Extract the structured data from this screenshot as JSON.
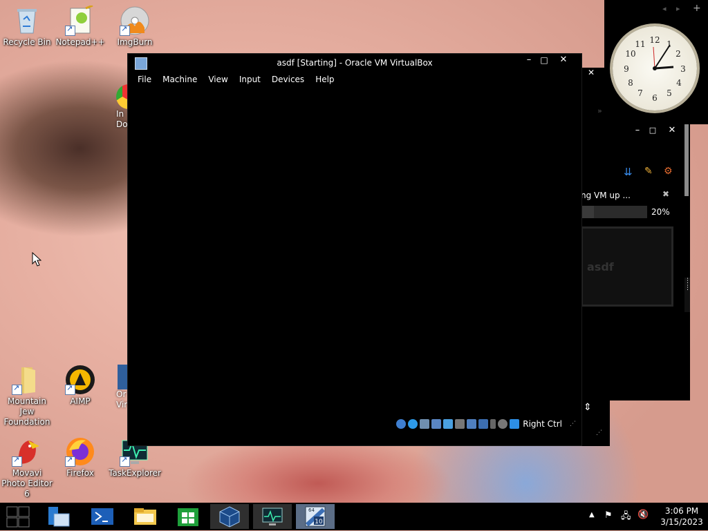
{
  "desktop": {
    "icons": [
      {
        "label": "Recycle Bin",
        "icon": "recycle-bin-icon"
      },
      {
        "label": "Notepad++",
        "icon": "notepad-plus-plus-icon"
      },
      {
        "label": "ImgBurn",
        "icon": "imgburn-icon"
      },
      {
        "label": "In\nDo",
        "icon": "chrome-partial-icon"
      },
      {
        "label": "Mountain Jew Foundation",
        "icon": "folder-icon"
      },
      {
        "label": "AIMP",
        "icon": "aimp-icon"
      },
      {
        "label": "Or\nVir",
        "icon": "virtualbox-partial-icon"
      },
      {
        "label": "Movavi Photo Editor 6",
        "icon": "movavi-icon"
      },
      {
        "label": "Firefox",
        "icon": "firefox-icon"
      },
      {
        "label": "TaskExplorer",
        "icon": "taskexplorer-icon"
      }
    ]
  },
  "vbox_window": {
    "title": "asdf [Starting] - Oracle VM VirtualBox",
    "menu": [
      "File",
      "Machine",
      "View",
      "Input",
      "Devices",
      "Help"
    ],
    "host_key": "Right Ctrl",
    "minimize": "–",
    "maximize": "□",
    "close": "✕"
  },
  "back_window": {
    "progress_text": "ng VM up ...",
    "progress_percent": "20%",
    "progress_value": 20,
    "vm_name": "asdf",
    "close": "✕",
    "minimize": "–",
    "maximize": "□"
  },
  "taskbar": {
    "time": "3:06 PM",
    "date": "3/15/2023"
  }
}
